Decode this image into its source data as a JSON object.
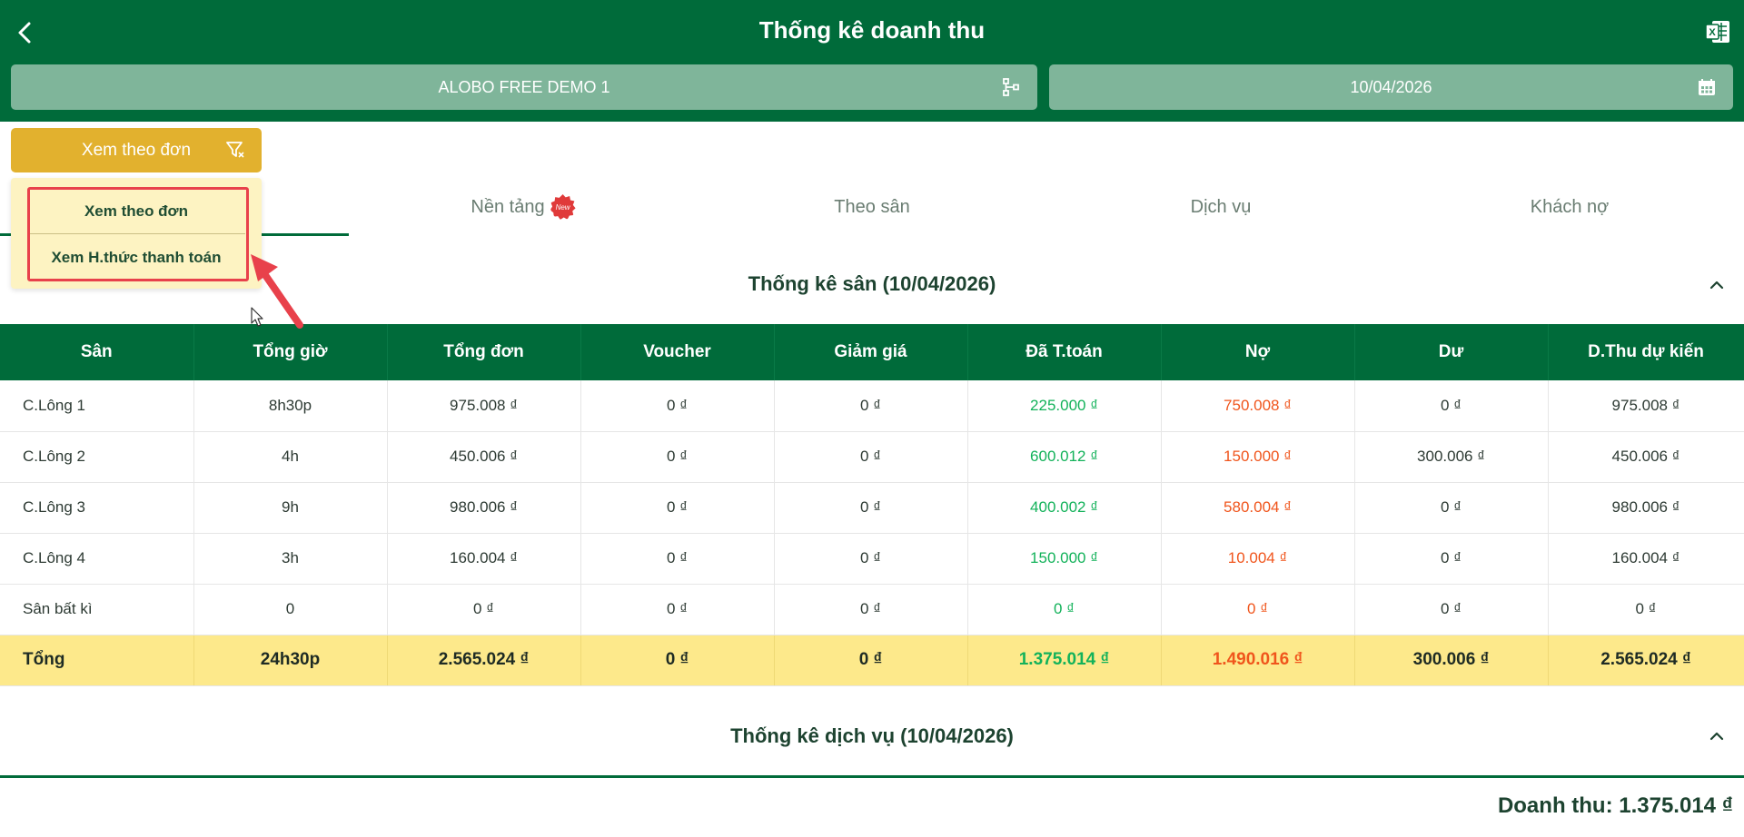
{
  "header": {
    "title": "Thống kê doanh thu",
    "back_icon": "chevron-left-icon",
    "export_icon": "excel-icon"
  },
  "filters": {
    "venue": "ALOBO FREE DEMO 1",
    "date": "10/04/2026",
    "view_mode": "Xem theo đơn"
  },
  "dropdown": {
    "options": [
      "Xem theo đơn",
      "Xem H.thức thanh toán"
    ]
  },
  "tabs": [
    {
      "label": "",
      "active": true
    },
    {
      "label": "Nền tảng",
      "badge": "New"
    },
    {
      "label": "Theo sân"
    },
    {
      "label": "Dịch vụ"
    },
    {
      "label": "Khách nợ"
    }
  ],
  "court_section": {
    "title": "Thống kê sân (10/04/2026)"
  },
  "table": {
    "headers": [
      "Sân",
      "Tổng giờ",
      "Tổng đơn",
      "Voucher",
      "Giảm giá",
      "Đã T.toán",
      "Nợ",
      "Dư",
      "D.Thu dự kiến"
    ],
    "rows": [
      [
        "C.Lông 1",
        "8h30p",
        "975.008 ₫",
        "0 ₫",
        "0 ₫",
        "225.000 ₫",
        "750.008 ₫",
        "0 ₫",
        "975.008 ₫"
      ],
      [
        "C.Lông 2",
        "4h",
        "450.006 ₫",
        "0 ₫",
        "0 ₫",
        "600.012 ₫",
        "150.000 ₫",
        "300.006 ₫",
        "450.006 ₫"
      ],
      [
        "C.Lông 3",
        "9h",
        "980.006 ₫",
        "0 ₫",
        "0 ₫",
        "400.002 ₫",
        "580.004 ₫",
        "0 ₫",
        "980.006 ₫"
      ],
      [
        "C.Lông 4",
        "3h",
        "160.004 ₫",
        "0 ₫",
        "0 ₫",
        "150.000 ₫",
        "10.004 ₫",
        "0 ₫",
        "160.004 ₫"
      ],
      [
        "Sân bất kì",
        "0",
        "0 ₫",
        "0 ₫",
        "0 ₫",
        "0 ₫",
        "0 ₫",
        "0 ₫",
        "0 ₫"
      ]
    ],
    "total": [
      "Tổng",
      "24h30p",
      "2.565.024 ₫",
      "0 ₫",
      "0 ₫",
      "1.375.014 ₫",
      "1.490.016 ₫",
      "300.006 ₫",
      "2.565.024 ₫"
    ]
  },
  "service_section": {
    "title": "Thống kê dịch vụ (10/04/2026)"
  },
  "footer": {
    "revenue": "Doanh thu: 1.375.014 ₫"
  },
  "colors": {
    "primary": "#006b3a",
    "accent": "#e2b12e",
    "paid": "#13b25a",
    "debt": "#f0551c",
    "total_row": "#fde98b",
    "highlight": "#e8414b"
  }
}
